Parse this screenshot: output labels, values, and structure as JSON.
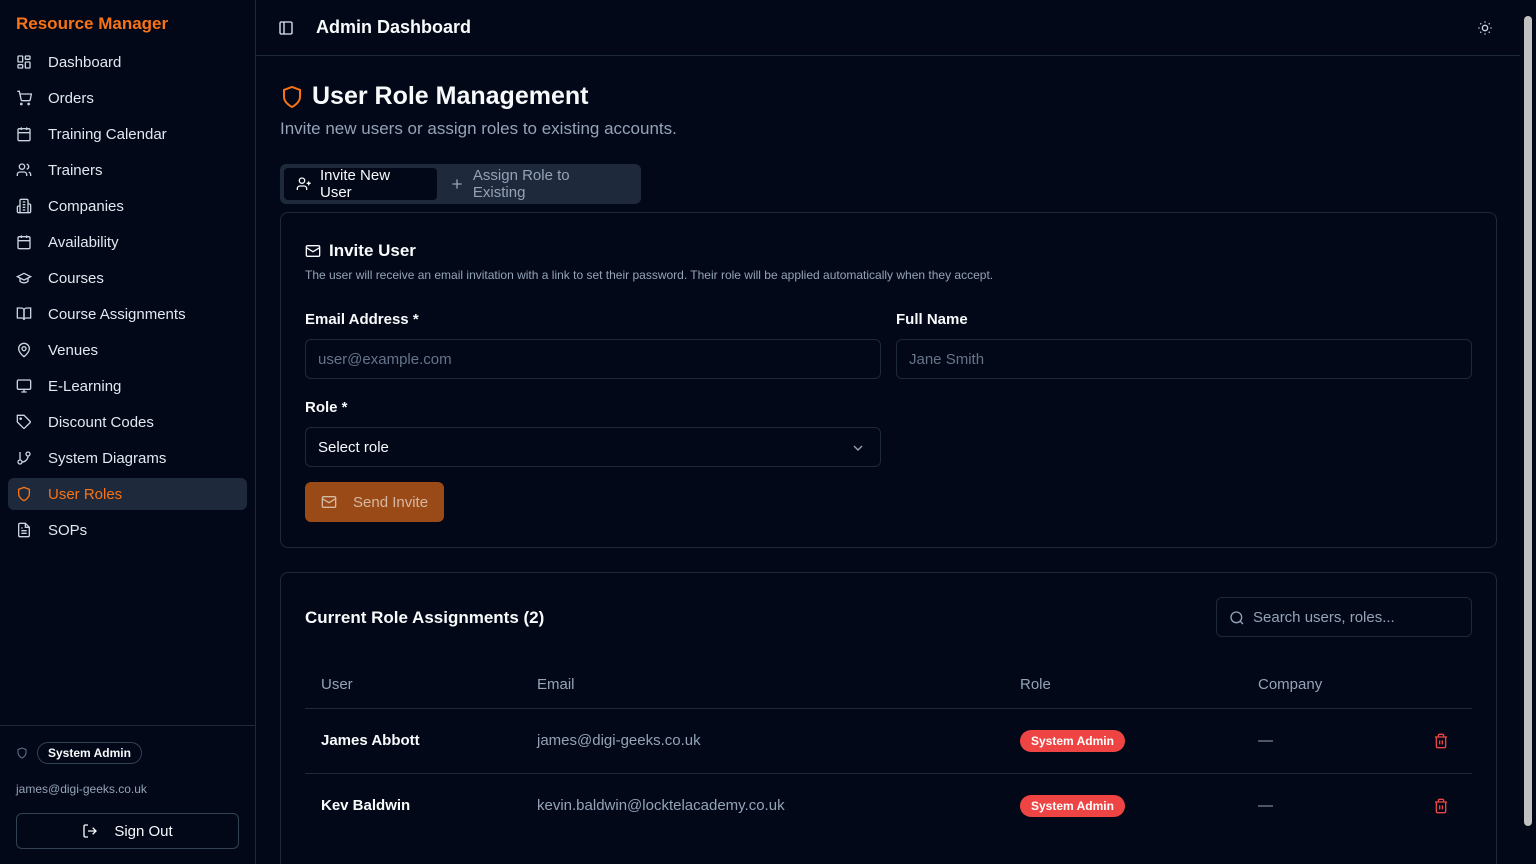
{
  "sidebar": {
    "brand": "Resource Manager",
    "items": [
      {
        "label": "Dashboard"
      },
      {
        "label": "Orders"
      },
      {
        "label": "Training Calendar"
      },
      {
        "label": "Trainers"
      },
      {
        "label": "Companies"
      },
      {
        "label": "Availability"
      },
      {
        "label": "Courses"
      },
      {
        "label": "Course Assignments"
      },
      {
        "label": "Venues"
      },
      {
        "label": "E-Learning"
      },
      {
        "label": "Discount Codes"
      },
      {
        "label": "System Diagrams"
      },
      {
        "label": "User Roles"
      },
      {
        "label": "SOPs"
      }
    ],
    "active_item": "User Roles",
    "footer": {
      "role_badge": "System Admin",
      "email": "james@digi-geeks.co.uk",
      "sign_out_label": "Sign Out"
    }
  },
  "header": {
    "title": "Admin Dashboard"
  },
  "page": {
    "title": "User Role Management",
    "subtitle": "Invite new users or assign roles to existing accounts.",
    "tabs": [
      {
        "label": "Invite New User",
        "active": true
      },
      {
        "label": "Assign Role to Existing",
        "active": false
      }
    ]
  },
  "invite_card": {
    "title": "Invite User",
    "description": "The user will receive an email invitation with a link to set their password. Their role will be applied automatically when they accept.",
    "email_label": "Email Address *",
    "email_placeholder": "user@example.com",
    "email_value": "",
    "name_label": "Full Name",
    "name_placeholder": "Jane Smith",
    "name_value": "",
    "role_label": "Role *",
    "role_value": "Select role",
    "send_label": "Send Invite"
  },
  "assignments": {
    "title": "Current Role Assignments (2)",
    "search_placeholder": "Search users, roles...",
    "columns": [
      "User",
      "Email",
      "Role",
      "Company"
    ],
    "rows": [
      {
        "user": "James Abbott",
        "email": "james@digi-geeks.co.uk",
        "role": "System Admin",
        "company": "—"
      },
      {
        "user": "Kev Baldwin",
        "email": "kevin.baldwin@locktelacademy.co.uk",
        "role": "System Admin",
        "company": "—"
      }
    ]
  },
  "colors": {
    "accent": "#f97316",
    "background": "#020817",
    "border": "#1e293b",
    "danger": "#ef4444"
  }
}
